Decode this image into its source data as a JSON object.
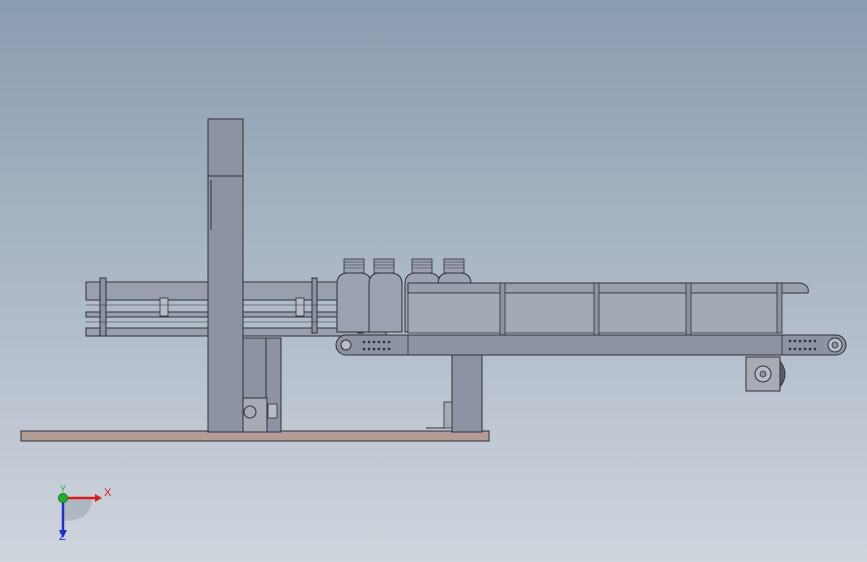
{
  "viewport": {
    "background_top": "#8a9cb0",
    "background_bottom": "#cfd5dd"
  },
  "model": {
    "part_fill": "#8e93a3",
    "part_edge": "#2f3138",
    "base_plate_fill": "#b39c96",
    "bottle_fill": "#9ca2b2",
    "motor_fill": "#a7abb6",
    "bottle_count": 4
  },
  "triad": {
    "x_label": "X",
    "y_label": "Y",
    "z_label": "Z",
    "x_color": "#d32020",
    "y_color": "#20b030",
    "z_color": "#2030c8"
  }
}
